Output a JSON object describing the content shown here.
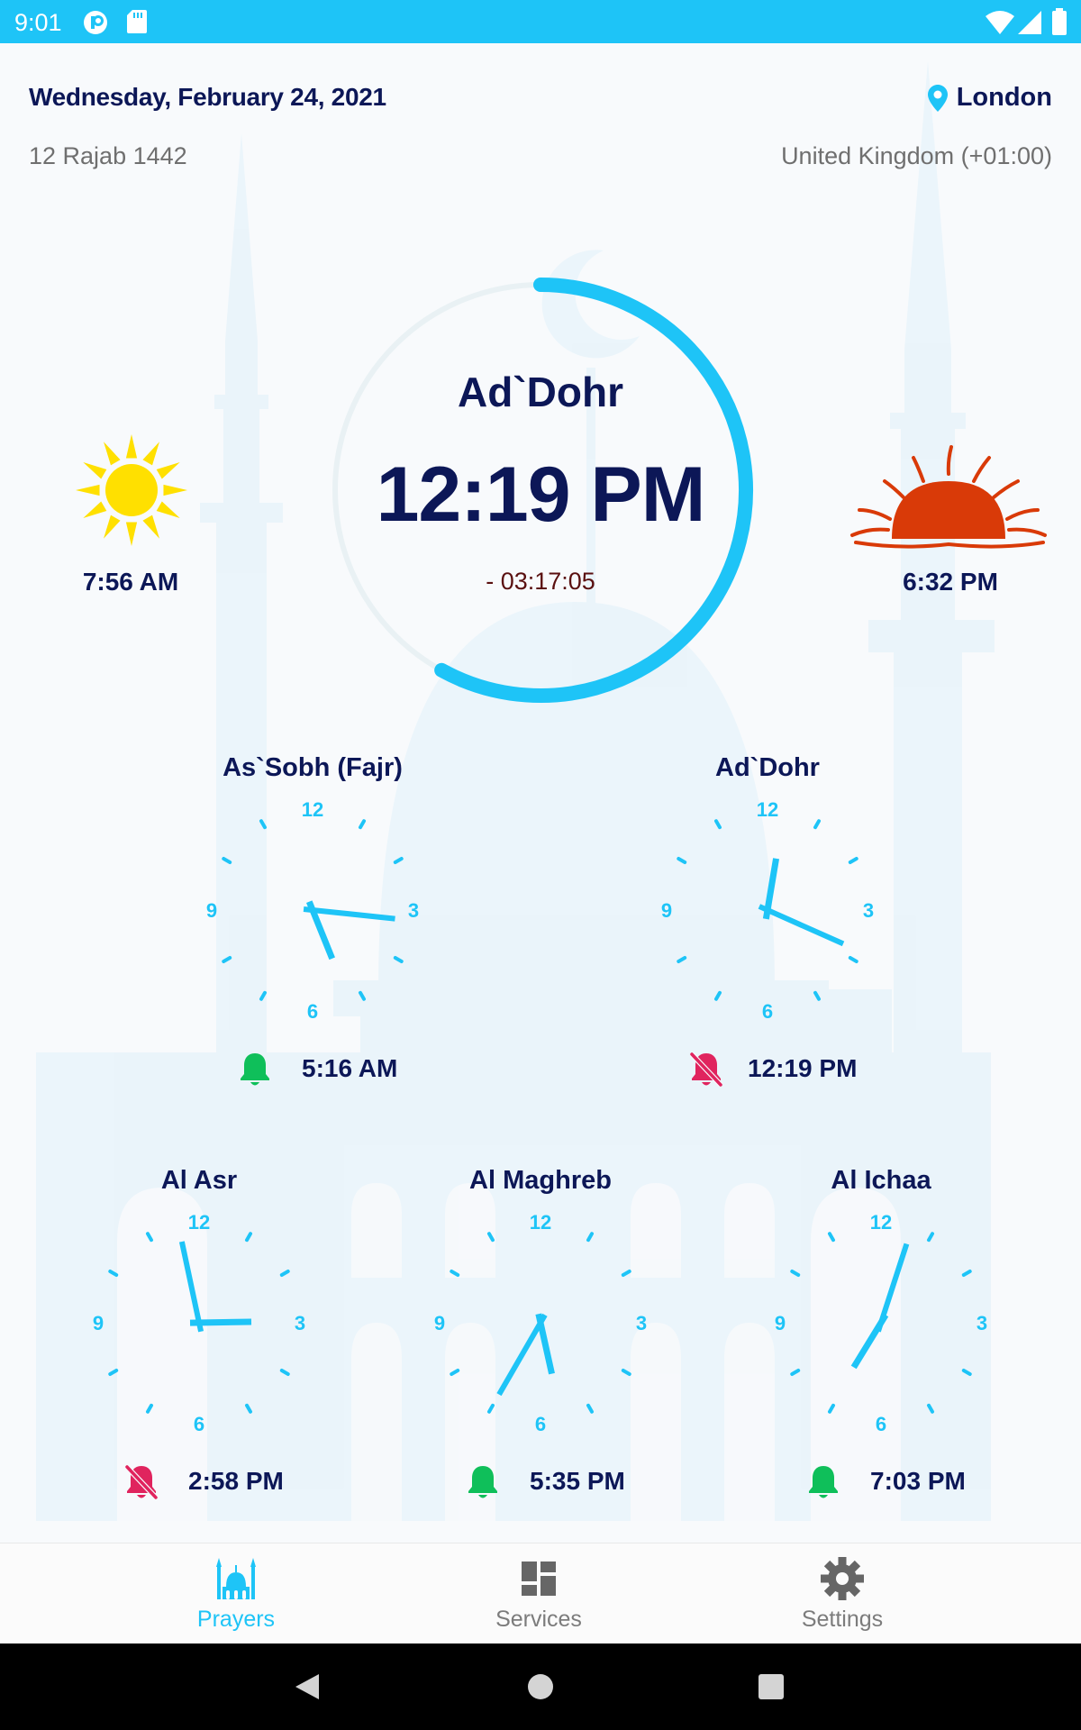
{
  "status_bar": {
    "time": "9:01",
    "icons": [
      "notification-app-icon",
      "sd-card-icon",
      "wifi-icon",
      "cellular-signal-icon",
      "battery-icon"
    ],
    "background_color": "#1ec4f7"
  },
  "header": {
    "gregorian_date": "Wednesday, February 24, 2021",
    "hijri_date": "12 Rajab 1442",
    "city": "London",
    "country_timezone": "United Kingdom (+01:00)",
    "location_icon": "location-pin-icon"
  },
  "current_prayer": {
    "name": "Ad`Dohr",
    "time": "12:19 PM",
    "countdown": "- 03:17:05",
    "progress": 0.58
  },
  "sun": {
    "sunrise_time": "7:56 AM",
    "sunset_time": "6:32 PM"
  },
  "prayers": [
    {
      "name": "As`Sobh (Fajr)",
      "time": "5:16 AM",
      "alarm_on": true,
      "hour": 5,
      "minute": 16
    },
    {
      "name": "Ad`Dohr",
      "time": "12:19 PM",
      "alarm_on": false,
      "hour": 12,
      "minute": 19
    },
    {
      "name": "Al Asr",
      "time": "2:58 PM",
      "alarm_on": false,
      "hour": 2,
      "minute": 58
    },
    {
      "name": "Al Maghreb",
      "time": "5:35 PM",
      "alarm_on": true,
      "hour": 5,
      "minute": 35
    },
    {
      "name": "Al Ichaa",
      "time": "7:03 PM",
      "alarm_on": true,
      "hour": 7,
      "minute": 3
    }
  ],
  "clock_numerals": [
    "12",
    "3",
    "6",
    "9"
  ],
  "bottom_nav": [
    {
      "label": "Prayers",
      "icon": "mosque-icon",
      "active": true
    },
    {
      "label": "Services",
      "icon": "grid-icon",
      "active": false
    },
    {
      "label": "Settings",
      "icon": "gear-icon",
      "active": false
    }
  ],
  "system_nav": [
    "back-button",
    "home-button",
    "recents-button"
  ],
  "colors": {
    "accent": "#1ec4f7",
    "navy": "#0c1757",
    "bell_on": "#0fbf5a",
    "bell_off": "#e0245e",
    "sun": "#ffe000",
    "sunset": "#d93a08"
  }
}
